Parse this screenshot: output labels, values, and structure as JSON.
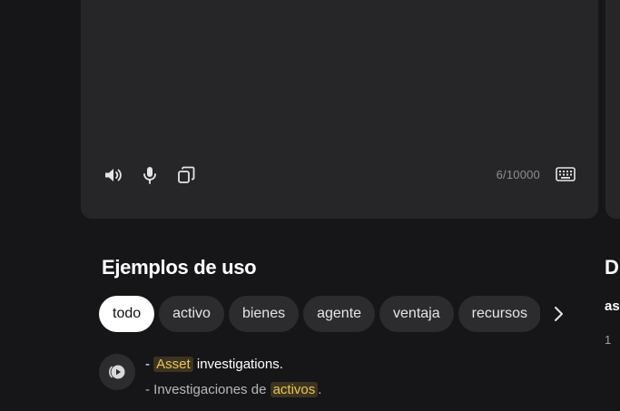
{
  "editor": {
    "char_count": "6/10000",
    "icons": [
      "speaker-icon",
      "microphone-icon",
      "copy-icon",
      "keyboard-icon"
    ]
  },
  "examples": {
    "title": "Ejemplos de uso",
    "chips": [
      "todo",
      "activo",
      "bienes",
      "agente",
      "ventaja",
      "recursos"
    ],
    "active_chip": "todo",
    "items": [
      {
        "source_prefix": "- ",
        "source_highlight": "Asset",
        "source_rest": " investigations.",
        "target_prefix": "- Investigaciones de ",
        "target_highlight": "activos",
        "target_rest": "."
      }
    ]
  },
  "side_panel": {
    "title": "D",
    "subtitle": "as",
    "number": "1"
  },
  "colors": {
    "background": "#161618",
    "card": "#262628",
    "chip": "#2c2c2e",
    "active_chip": "#ffffff",
    "highlight_text": "#f0c44a",
    "highlight_bg": "#3a3420"
  }
}
